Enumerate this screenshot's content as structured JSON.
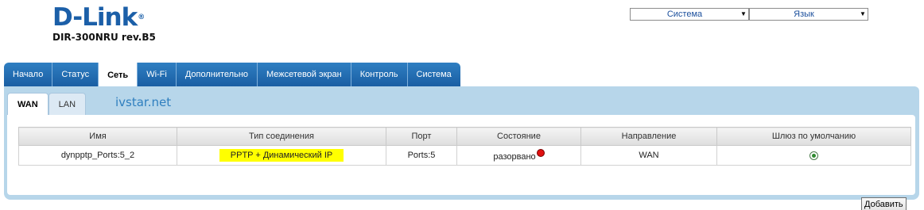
{
  "brand": {
    "logo_text": "D-Link",
    "registered": "®",
    "model": "DIR-300NRU rev.B5"
  },
  "top_menu": {
    "system_select": "Система",
    "language_select": "Язык"
  },
  "main_tabs": [
    {
      "label": "Начало"
    },
    {
      "label": "Статус"
    },
    {
      "label": "Сеть"
    },
    {
      "label": "Wi-Fi"
    },
    {
      "label": "Дополнительно"
    },
    {
      "label": "Межсетевой экран"
    },
    {
      "label": "Контроль"
    },
    {
      "label": "Система"
    }
  ],
  "active_main_tab": "Сеть",
  "sub_tabs": [
    {
      "label": "WAN"
    },
    {
      "label": "LAN"
    }
  ],
  "active_sub_tab": "WAN",
  "watermark": "ivstar.net",
  "table": {
    "columns": [
      "Имя",
      "Тип соединения",
      "Порт",
      "Состояние",
      "Направление",
      "Шлюз по умолчанию"
    ],
    "rows": [
      {
        "name": "dynpptp_Ports:5_2",
        "type": "PPTP + Динамический IP",
        "port": "Ports:5",
        "state": "разорвано",
        "direction": "WAN",
        "default_gateway": true
      }
    ]
  },
  "buttons": {
    "add_label": "Добавить"
  },
  "colors": {
    "brand_blue": "#1b5fa8",
    "tab_blue": "#2a78bd",
    "panel_bg": "#b7d6ea",
    "highlight": "#ffff00",
    "status_red": "#e01010"
  }
}
